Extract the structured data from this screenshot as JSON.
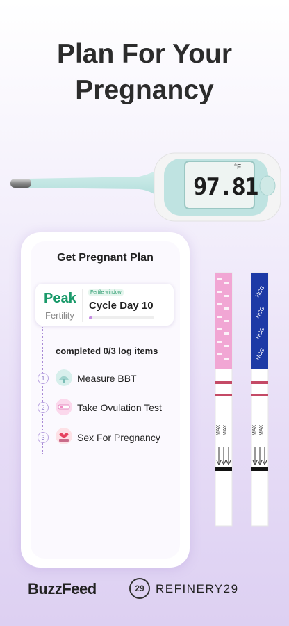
{
  "headline": {
    "line1": "Plan For Your",
    "line2": "Pregnancy"
  },
  "thermometer": {
    "reading": "97.81",
    "unit": "°F"
  },
  "plan": {
    "title": "Get Pregnant Plan",
    "status_label": "Peak",
    "status_sub": "Fertility",
    "window_badge": "Fertile window",
    "cycle_day": "Cycle Day 10",
    "cycle_progress": 0.05
  },
  "log": {
    "completed_text": "completed 0/3 log items",
    "items": [
      {
        "num": "1",
        "label": "Measure BBT",
        "icon": "thermometer-icon"
      },
      {
        "num": "2",
        "label": "Take Ovulation Test",
        "icon": "ovulation-test-icon"
      },
      {
        "num": "3",
        "label": "Sex For Pregnancy",
        "icon": "heart-bed-icon"
      }
    ]
  },
  "strips": {
    "left_color": "#f1a6d4",
    "right_color": "#1d3aa6",
    "right_text": "HCG",
    "max_text": "MAX"
  },
  "brands": {
    "left": "BuzzFeed",
    "right": "REFINERY29",
    "right_mark": "29"
  }
}
